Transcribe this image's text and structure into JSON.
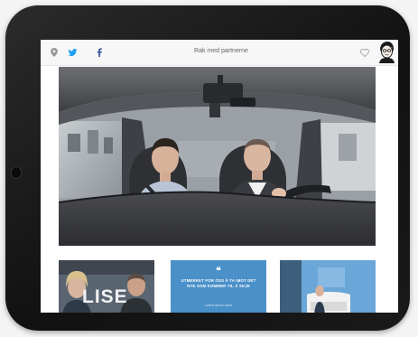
{
  "topbar": {
    "title": "Rak med partnerne",
    "icons": [
      "map-pin-icon",
      "twitter-icon",
      "facebook-icon",
      "heart-icon"
    ]
  },
  "hero": {
    "kind": "video-frame",
    "scene": "two-men-in-car-front-seats"
  },
  "thumbnails": [
    {
      "kind": "photo",
      "overlay_text": "LISE"
    },
    {
      "kind": "quote-card",
      "quote_mark": "❝",
      "quote": "Utmerket for oss å ta imot det nye som kommer til å skje",
      "author": "Lorem Ipsum Dolor"
    },
    {
      "kind": "photo",
      "overlay_text": ""
    }
  ],
  "colors": {
    "twitter": "#1da1f2",
    "facebook": "#3b5998",
    "quote_card": "#4a90c9"
  }
}
